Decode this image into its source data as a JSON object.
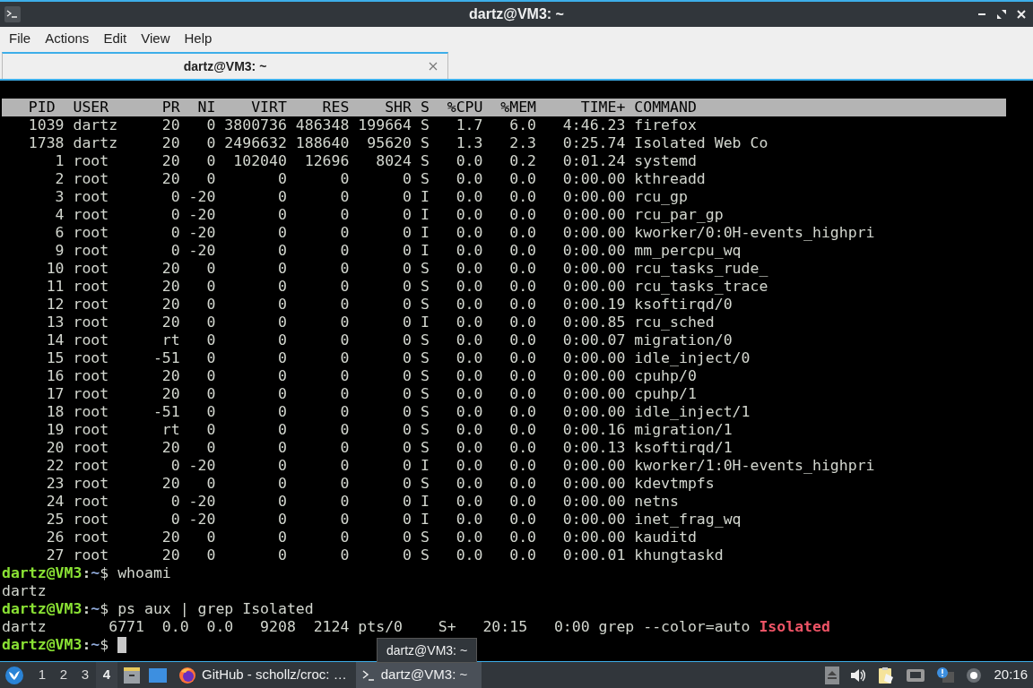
{
  "window": {
    "title": "dartz@VM3: ~"
  },
  "menu": [
    "File",
    "Actions",
    "Edit",
    "View",
    "Help"
  ],
  "tabs": [
    {
      "title": "dartz@VM3: ~",
      "selected": true
    }
  ],
  "terminal": {
    "top_header": [
      "PID",
      "USER",
      "PR",
      "NI",
      "VIRT",
      "RES",
      "SHR",
      "S",
      "%CPU",
      "%MEM",
      "TIME+",
      "COMMAND"
    ],
    "processes": [
      {
        "pid": "1039",
        "user": "dartz",
        "pr": "20",
        "ni": "0",
        "virt": "3800736",
        "res": "486348",
        "shr": "199664",
        "s": "S",
        "cpu": "1.7",
        "mem": "6.0",
        "time": "4:46.23",
        "command": "firefox"
      },
      {
        "pid": "1738",
        "user": "dartz",
        "pr": "20",
        "ni": "0",
        "virt": "2496632",
        "res": "188640",
        "shr": "95620",
        "s": "S",
        "cpu": "1.3",
        "mem": "2.3",
        "time": "0:25.74",
        "command": "Isolated Web Co"
      },
      {
        "pid": "1",
        "user": "root",
        "pr": "20",
        "ni": "0",
        "virt": "102040",
        "res": "12696",
        "shr": "8024",
        "s": "S",
        "cpu": "0.0",
        "mem": "0.2",
        "time": "0:01.24",
        "command": "systemd"
      },
      {
        "pid": "2",
        "user": "root",
        "pr": "20",
        "ni": "0",
        "virt": "0",
        "res": "0",
        "shr": "0",
        "s": "S",
        "cpu": "0.0",
        "mem": "0.0",
        "time": "0:00.00",
        "command": "kthreadd"
      },
      {
        "pid": "3",
        "user": "root",
        "pr": "0",
        "ni": "-20",
        "virt": "0",
        "res": "0",
        "shr": "0",
        "s": "I",
        "cpu": "0.0",
        "mem": "0.0",
        "time": "0:00.00",
        "command": "rcu_gp"
      },
      {
        "pid": "4",
        "user": "root",
        "pr": "0",
        "ni": "-20",
        "virt": "0",
        "res": "0",
        "shr": "0",
        "s": "I",
        "cpu": "0.0",
        "mem": "0.0",
        "time": "0:00.00",
        "command": "rcu_par_gp"
      },
      {
        "pid": "6",
        "user": "root",
        "pr": "0",
        "ni": "-20",
        "virt": "0",
        "res": "0",
        "shr": "0",
        "s": "I",
        "cpu": "0.0",
        "mem": "0.0",
        "time": "0:00.00",
        "command": "kworker/0:0H-events_highpri"
      },
      {
        "pid": "9",
        "user": "root",
        "pr": "0",
        "ni": "-20",
        "virt": "0",
        "res": "0",
        "shr": "0",
        "s": "I",
        "cpu": "0.0",
        "mem": "0.0",
        "time": "0:00.00",
        "command": "mm_percpu_wq"
      },
      {
        "pid": "10",
        "user": "root",
        "pr": "20",
        "ni": "0",
        "virt": "0",
        "res": "0",
        "shr": "0",
        "s": "S",
        "cpu": "0.0",
        "mem": "0.0",
        "time": "0:00.00",
        "command": "rcu_tasks_rude_"
      },
      {
        "pid": "11",
        "user": "root",
        "pr": "20",
        "ni": "0",
        "virt": "0",
        "res": "0",
        "shr": "0",
        "s": "S",
        "cpu": "0.0",
        "mem": "0.0",
        "time": "0:00.00",
        "command": "rcu_tasks_trace"
      },
      {
        "pid": "12",
        "user": "root",
        "pr": "20",
        "ni": "0",
        "virt": "0",
        "res": "0",
        "shr": "0",
        "s": "S",
        "cpu": "0.0",
        "mem": "0.0",
        "time": "0:00.19",
        "command": "ksoftirqd/0"
      },
      {
        "pid": "13",
        "user": "root",
        "pr": "20",
        "ni": "0",
        "virt": "0",
        "res": "0",
        "shr": "0",
        "s": "I",
        "cpu": "0.0",
        "mem": "0.0",
        "time": "0:00.85",
        "command": "rcu_sched"
      },
      {
        "pid": "14",
        "user": "root",
        "pr": "rt",
        "ni": "0",
        "virt": "0",
        "res": "0",
        "shr": "0",
        "s": "S",
        "cpu": "0.0",
        "mem": "0.0",
        "time": "0:00.07",
        "command": "migration/0"
      },
      {
        "pid": "15",
        "user": "root",
        "pr": "-51",
        "ni": "0",
        "virt": "0",
        "res": "0",
        "shr": "0",
        "s": "S",
        "cpu": "0.0",
        "mem": "0.0",
        "time": "0:00.00",
        "command": "idle_inject/0"
      },
      {
        "pid": "16",
        "user": "root",
        "pr": "20",
        "ni": "0",
        "virt": "0",
        "res": "0",
        "shr": "0",
        "s": "S",
        "cpu": "0.0",
        "mem": "0.0",
        "time": "0:00.00",
        "command": "cpuhp/0"
      },
      {
        "pid": "17",
        "user": "root",
        "pr": "20",
        "ni": "0",
        "virt": "0",
        "res": "0",
        "shr": "0",
        "s": "S",
        "cpu": "0.0",
        "mem": "0.0",
        "time": "0:00.00",
        "command": "cpuhp/1"
      },
      {
        "pid": "18",
        "user": "root",
        "pr": "-51",
        "ni": "0",
        "virt": "0",
        "res": "0",
        "shr": "0",
        "s": "S",
        "cpu": "0.0",
        "mem": "0.0",
        "time": "0:00.00",
        "command": "idle_inject/1"
      },
      {
        "pid": "19",
        "user": "root",
        "pr": "rt",
        "ni": "0",
        "virt": "0",
        "res": "0",
        "shr": "0",
        "s": "S",
        "cpu": "0.0",
        "mem": "0.0",
        "time": "0:00.16",
        "command": "migration/1"
      },
      {
        "pid": "20",
        "user": "root",
        "pr": "20",
        "ni": "0",
        "virt": "0",
        "res": "0",
        "shr": "0",
        "s": "S",
        "cpu": "0.0",
        "mem": "0.0",
        "time": "0:00.13",
        "command": "ksoftirqd/1"
      },
      {
        "pid": "22",
        "user": "root",
        "pr": "0",
        "ni": "-20",
        "virt": "0",
        "res": "0",
        "shr": "0",
        "s": "I",
        "cpu": "0.0",
        "mem": "0.0",
        "time": "0:00.00",
        "command": "kworker/1:0H-events_highpri"
      },
      {
        "pid": "23",
        "user": "root",
        "pr": "20",
        "ni": "0",
        "virt": "0",
        "res": "0",
        "shr": "0",
        "s": "S",
        "cpu": "0.0",
        "mem": "0.0",
        "time": "0:00.00",
        "command": "kdevtmpfs"
      },
      {
        "pid": "24",
        "user": "root",
        "pr": "0",
        "ni": "-20",
        "virt": "0",
        "res": "0",
        "shr": "0",
        "s": "I",
        "cpu": "0.0",
        "mem": "0.0",
        "time": "0:00.00",
        "command": "netns"
      },
      {
        "pid": "25",
        "user": "root",
        "pr": "0",
        "ni": "-20",
        "virt": "0",
        "res": "0",
        "shr": "0",
        "s": "I",
        "cpu": "0.0",
        "mem": "0.0",
        "time": "0:00.00",
        "command": "inet_frag_wq"
      },
      {
        "pid": "26",
        "user": "root",
        "pr": "20",
        "ni": "0",
        "virt": "0",
        "res": "0",
        "shr": "0",
        "s": "S",
        "cpu": "0.0",
        "mem": "0.0",
        "time": "0:00.00",
        "command": "kauditd"
      },
      {
        "pid": "27",
        "user": "root",
        "pr": "20",
        "ni": "0",
        "virt": "0",
        "res": "0",
        "shr": "0",
        "s": "S",
        "cpu": "0.0",
        "mem": "0.0",
        "time": "0:00.01",
        "command": "khungtaskd"
      }
    ],
    "shell_lines": [
      {
        "kind": "prompt",
        "user_host": "dartz@VM3",
        "separator": ":",
        "path": "~",
        "sign": "$",
        "command": "whoami"
      },
      {
        "kind": "output",
        "text": "dartz"
      },
      {
        "kind": "prompt",
        "user_host": "dartz@VM3",
        "separator": ":",
        "path": "~",
        "sign": "$",
        "command": "ps aux | grep Isolated"
      },
      {
        "kind": "output",
        "text": "dartz       6771  0.0  0.0   9208  2124 pts/0    S+   20:15   0:00 grep --color=auto ",
        "match": "Isolated"
      },
      {
        "kind": "prompt",
        "user_host": "dartz@VM3",
        "separator": ":",
        "path": "~",
        "sign": "$",
        "cursor": true
      }
    ]
  },
  "tooltip": "dartz@VM3: ~",
  "taskbar": {
    "workspaces": [
      {
        "label": "1",
        "selected": false
      },
      {
        "label": "2",
        "selected": false
      },
      {
        "label": "3",
        "selected": false
      },
      {
        "label": "4",
        "selected": true
      }
    ],
    "tasks": [
      {
        "kind": "browser",
        "label": "GitHub - schollz/croc: …",
        "selected": false
      },
      {
        "kind": "terminal",
        "label": "dartz@VM3: ~",
        "selected": true
      }
    ],
    "clock": "20:16"
  }
}
